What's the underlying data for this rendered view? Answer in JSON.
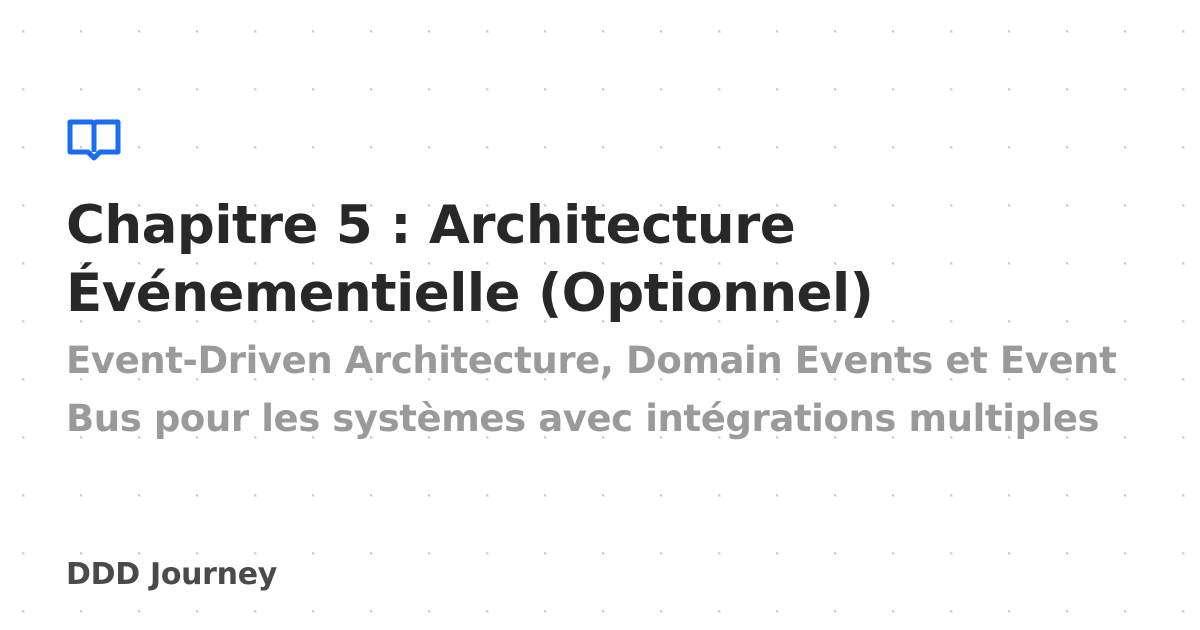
{
  "card": {
    "title": "Chapitre 5 : Architecture Événementielle (Optionnel)",
    "subtitle": "Event-Driven Architecture, Domain Events et Event Bus pour les systèmes avec intégrations multiples",
    "brand": "DDD Journey"
  },
  "icons": {
    "logo": "open-book-icon"
  },
  "colors": {
    "accent": "#1a6cf0",
    "title": "#282828",
    "subtitle": "#9a9a9a",
    "brand": "#4a4a4a",
    "background": "#ffffff",
    "pattern": "#cfcfcf"
  }
}
